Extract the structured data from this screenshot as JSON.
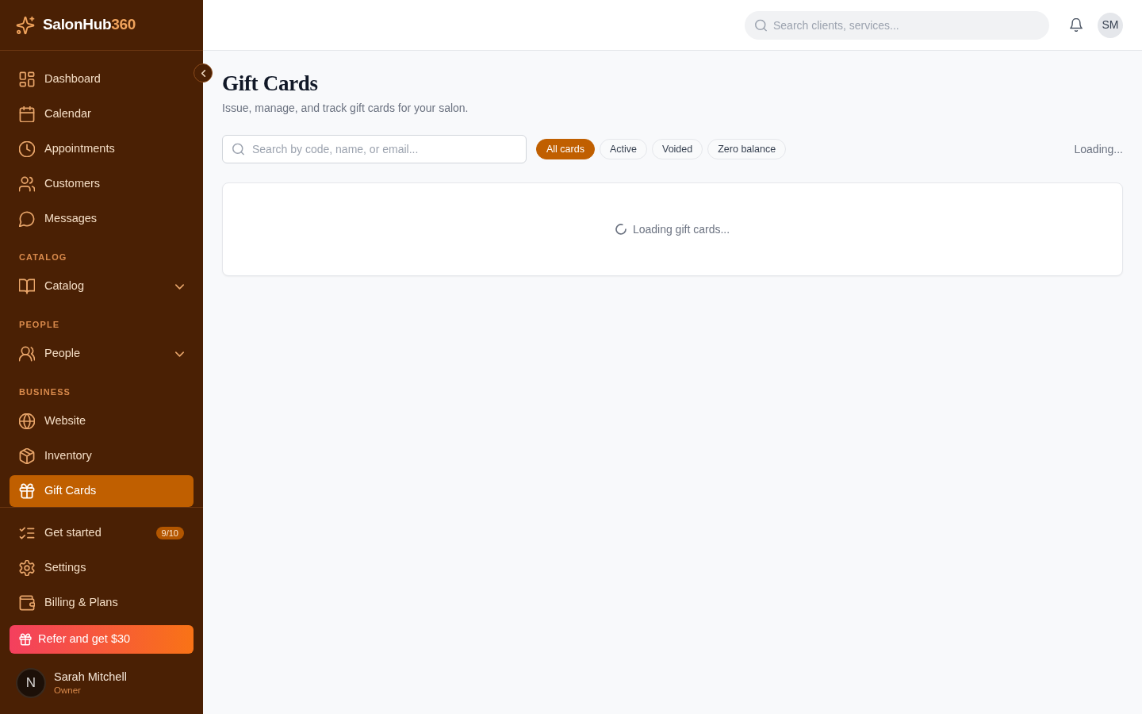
{
  "brand": {
    "name": "SalonHub",
    "suffix": "360"
  },
  "sidebar": {
    "sections": [
      {
        "items": [
          {
            "label": "Dashboard",
            "selected": false
          },
          {
            "label": "Calendar",
            "selected": false
          },
          {
            "label": "Appointments",
            "selected": false
          },
          {
            "label": "Customers",
            "selected": false
          },
          {
            "label": "Messages",
            "selected": false
          }
        ]
      },
      {
        "heading": "CATALOG",
        "items": [
          {
            "label": "Catalog",
            "selected": false,
            "expanded": false
          }
        ]
      },
      {
        "heading": "PEOPLE",
        "items": [
          {
            "label": "People",
            "selected": false,
            "expanded": false
          }
        ]
      },
      {
        "heading": "BUSINESS",
        "items": [
          {
            "label": "Website",
            "selected": false
          },
          {
            "label": "Inventory",
            "selected": false
          },
          {
            "label": "Gift Cards",
            "selected": true
          }
        ]
      }
    ],
    "footer_items": [
      {
        "label": "Get started",
        "selected": false,
        "badge": "9/10"
      },
      {
        "label": "Settings",
        "selected": false
      },
      {
        "label": "Billing & Plans",
        "selected": false
      }
    ],
    "referral_button": "Refer and get $30",
    "user": {
      "avatar": "N",
      "name": "Sarah Mitchell",
      "role": "Owner"
    }
  },
  "topbar": {
    "search": {
      "placeholder": "Search clients, services..."
    },
    "avatar": "SM"
  },
  "page": {
    "title": "Gift Cards",
    "subtitle": "Issue, manage, and track gift cards for your salon.",
    "search": {
      "placeholder": "Search by code, name, or email..."
    },
    "filters": [
      {
        "label": "All cards",
        "selected": true
      },
      {
        "label": "Active",
        "selected": false
      },
      {
        "label": "Voided",
        "selected": false
      },
      {
        "label": "Zero balance",
        "selected": false
      }
    ],
    "status": "Loading...",
    "loading_message": "Loading gift cards..."
  }
}
